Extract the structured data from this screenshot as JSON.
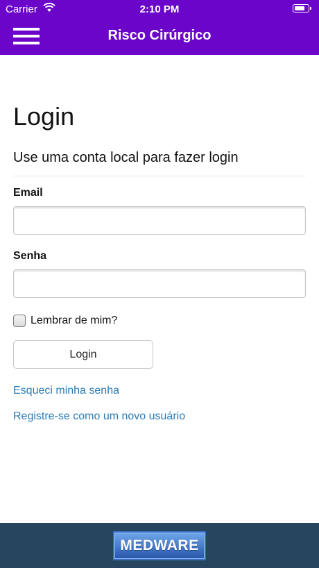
{
  "status_bar": {
    "carrier": "Carrier",
    "time": "2:10 PM",
    "wifi_icon": "wifi-icon",
    "battery_icon": "battery-icon"
  },
  "navbar": {
    "menu_icon": "hamburger-menu-icon",
    "title": "Risco Cirúrgico",
    "color": "#6a05c9"
  },
  "login": {
    "title": "Login",
    "subtitle": "Use uma conta local para fazer login",
    "email_label": "Email",
    "email_value": "",
    "password_label": "Senha",
    "password_value": "",
    "remember_label": "Lembrar de mim?",
    "remember_checked": false,
    "submit_label": "Login",
    "forgot_link": "Esqueci minha senha",
    "register_link": "Registre-se como um novo usuário",
    "link_color": "#2a7bb8"
  },
  "footer": {
    "logo_text": "MEDWARE",
    "background": "#27455f"
  }
}
